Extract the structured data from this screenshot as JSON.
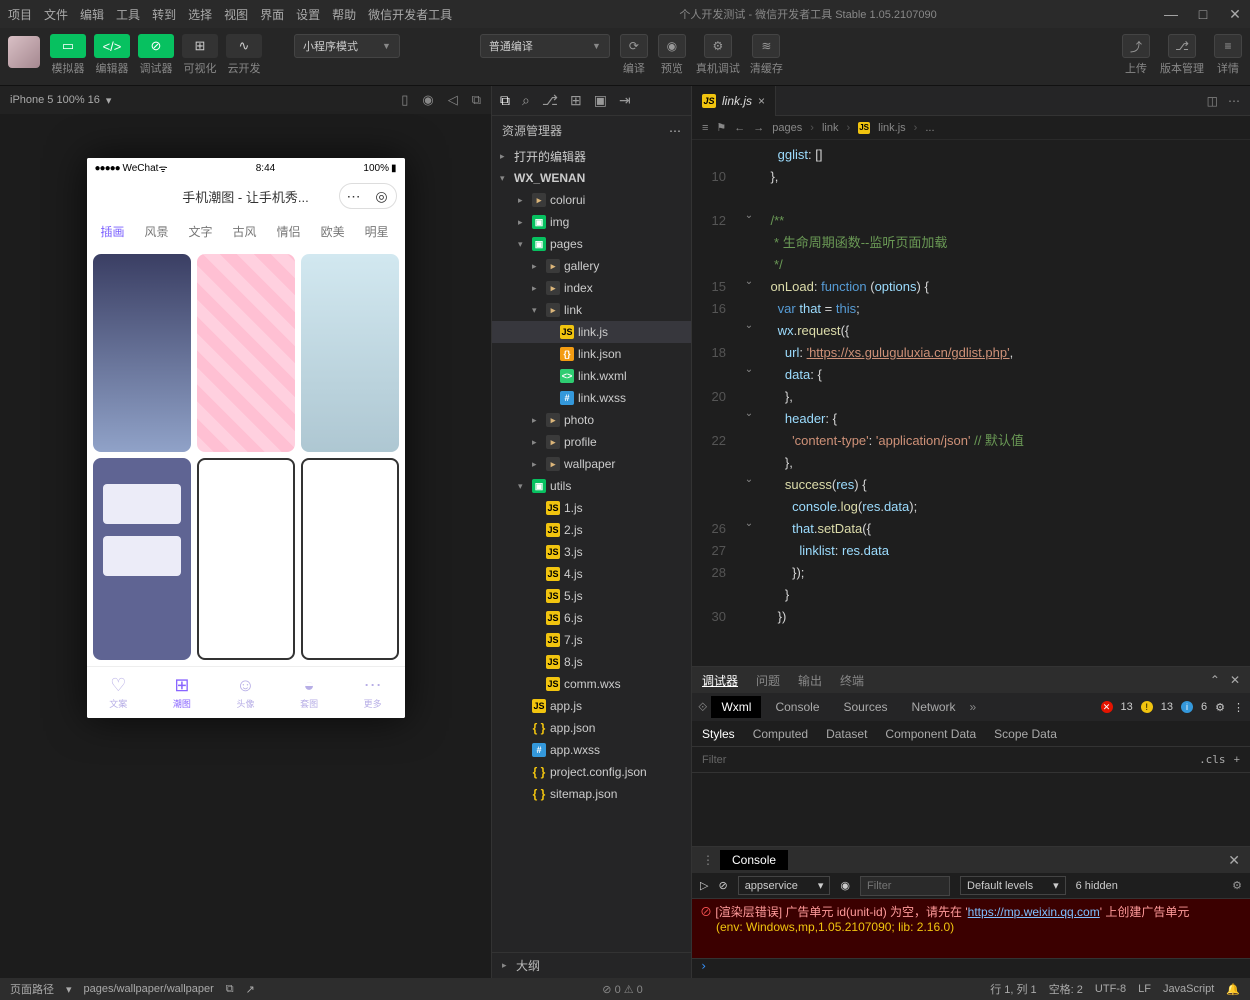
{
  "menu": [
    "项目",
    "文件",
    "编辑",
    "工具",
    "转到",
    "选择",
    "视图",
    "界面",
    "设置",
    "帮助",
    "微信开发者工具"
  ],
  "window_title": "个人开发测试 - 微信开发者工具 Stable 1.05.2107090",
  "toolbar": {
    "sim": "模拟器",
    "editor": "编辑器",
    "debugger": "调试器",
    "visual": "可视化",
    "cloud": "云开发",
    "mode": "小程序模式",
    "compile_mode": "普通编译",
    "compile": "编译",
    "preview": "预览",
    "truedbg": "真机调试",
    "clear_cache": "清缓存",
    "upload": "上传",
    "version": "版本管理",
    "details": "详情"
  },
  "sim": {
    "device": "iPhone 5 100% 16",
    "arrow": "▾"
  },
  "phone": {
    "carrier": "WeChat",
    "time": "8:44",
    "battery": "100%",
    "title": "手机潮图 - 让手机秀...",
    "tabs": [
      "插画",
      "风景",
      "文字",
      "古风",
      "情侣",
      "欧美",
      "明星"
    ],
    "tabbar": [
      {
        "icon": "♡",
        "label": "文案"
      },
      {
        "icon": "⊞",
        "label": "潮图"
      },
      {
        "icon": "☺",
        "label": "头像"
      },
      {
        "icon": "◒",
        "label": "套图"
      },
      {
        "icon": "⋯",
        "label": "更多"
      }
    ]
  },
  "explorer": {
    "title": "资源管理器",
    "sections": {
      "open_editors": "打开的编辑器",
      "project": "WX_WENAN",
      "outline": "大纲"
    },
    "tree": [
      {
        "d": 1,
        "tw": "▸",
        "ico": "folder",
        "name": "colorui"
      },
      {
        "d": 1,
        "tw": "▸",
        "ico": "pages",
        "name": "img"
      },
      {
        "d": 1,
        "tw": "▾",
        "ico": "pages",
        "name": "pages"
      },
      {
        "d": 2,
        "tw": "▸",
        "ico": "folder",
        "name": "gallery"
      },
      {
        "d": 2,
        "tw": "▸",
        "ico": "folder",
        "name": "index"
      },
      {
        "d": 2,
        "tw": "▾",
        "ico": "folder",
        "name": "link"
      },
      {
        "d": 3,
        "tw": "",
        "ico": "js",
        "name": "link.js",
        "sel": true
      },
      {
        "d": 3,
        "tw": "",
        "ico": "json",
        "name": "link.json"
      },
      {
        "d": 3,
        "tw": "",
        "ico": "wxml",
        "name": "link.wxml"
      },
      {
        "d": 3,
        "tw": "",
        "ico": "wxss",
        "name": "link.wxss"
      },
      {
        "d": 2,
        "tw": "▸",
        "ico": "folder",
        "name": "photo"
      },
      {
        "d": 2,
        "tw": "▸",
        "ico": "folder",
        "name": "profile"
      },
      {
        "d": 2,
        "tw": "▸",
        "ico": "folder",
        "name": "wallpaper"
      },
      {
        "d": 1,
        "tw": "▾",
        "ico": "utils",
        "name": "utils"
      },
      {
        "d": 2,
        "tw": "",
        "ico": "js",
        "name": "1.js"
      },
      {
        "d": 2,
        "tw": "",
        "ico": "js",
        "name": "2.js"
      },
      {
        "d": 2,
        "tw": "",
        "ico": "js",
        "name": "3.js"
      },
      {
        "d": 2,
        "tw": "",
        "ico": "js",
        "name": "4.js"
      },
      {
        "d": 2,
        "tw": "",
        "ico": "js",
        "name": "5.js"
      },
      {
        "d": 2,
        "tw": "",
        "ico": "js",
        "name": "6.js"
      },
      {
        "d": 2,
        "tw": "",
        "ico": "js",
        "name": "7.js"
      },
      {
        "d": 2,
        "tw": "",
        "ico": "js",
        "name": "8.js"
      },
      {
        "d": 2,
        "tw": "",
        "ico": "js",
        "name": "comm.wxs"
      },
      {
        "d": 1,
        "tw": "",
        "ico": "js",
        "name": "app.js"
      },
      {
        "d": 1,
        "tw": "",
        "ico": "json2",
        "name": "app.json"
      },
      {
        "d": 1,
        "tw": "",
        "ico": "wxss",
        "name": "app.wxss"
      },
      {
        "d": 1,
        "tw": "",
        "ico": "json2",
        "name": "project.config.json"
      },
      {
        "d": 1,
        "tw": "",
        "ico": "json2",
        "name": "sitemap.json"
      }
    ]
  },
  "editor": {
    "tab": "link.js",
    "breadcrumb": [
      "pages",
      "link",
      "link.js",
      "..."
    ],
    "lines": [
      {
        "n": "",
        "fold": "",
        "html": "      <span class='c-prop'>gglist</span>: []"
      },
      {
        "n": "10",
        "fold": "",
        "html": "    },"
      },
      {
        "n": "",
        "fold": "",
        "html": ""
      },
      {
        "n": "12",
        "fold": "⌄",
        "html": "    <span class='c-comment'>/**</span>"
      },
      {
        "n": "",
        "fold": "",
        "html": "<span class='c-comment'>     * 生命周期函数--监听页面加载</span>"
      },
      {
        "n": "",
        "fold": "",
        "html": "<span class='c-comment'>     */</span>"
      },
      {
        "n": "15",
        "fold": "⌄",
        "html": "    <span class='c-method'>onLoad</span>: <span class='c-func'>function</span> (<span class='c-var'>options</span>) {"
      },
      {
        "n": "16",
        "fold": "",
        "html": "      <span class='c-func'>var</span> <span class='c-var'>that</span> = <span class='c-func'>this</span>;"
      },
      {
        "n": "",
        "fold": "⌄",
        "html": "      <span class='c-var'>wx</span>.<span class='c-method'>request</span>({"
      },
      {
        "n": "18",
        "fold": "",
        "html": "        <span class='c-prop'>url</span>: <span class='c-url'>'https://xs.guluguluxia.cn/gdlist.php'</span>,"
      },
      {
        "n": "",
        "fold": "⌄",
        "html": "        <span class='c-prop'>data</span>: {"
      },
      {
        "n": "20",
        "fold": "",
        "html": "        },"
      },
      {
        "n": "",
        "fold": "⌄",
        "html": "        <span class='c-prop'>header</span>: {"
      },
      {
        "n": "22",
        "fold": "",
        "html": "          <span class='c-str'>'content-type'</span>: <span class='c-str'>'application/json'</span> <span class='c-comment'>// 默认值</span>"
      },
      {
        "n": "",
        "fold": "",
        "html": "        },"
      },
      {
        "n": "",
        "fold": "⌄",
        "html": "        <span class='c-method'>success</span>(<span class='c-var'>res</span>) {"
      },
      {
        "n": "",
        "fold": "",
        "html": "          <span class='c-var'>console</span>.<span class='c-method'>log</span>(<span class='c-var'>res</span>.<span class='c-var'>data</span>);"
      },
      {
        "n": "26",
        "fold": "⌄",
        "html": "          <span class='c-var'>that</span>.<span class='c-method'>setData</span>({"
      },
      {
        "n": "27",
        "fold": "",
        "html": "            <span class='c-prop'>linklist</span>: <span class='c-var'>res</span>.<span class='c-var'>data</span>"
      },
      {
        "n": "28",
        "fold": "",
        "html": "          });"
      },
      {
        "n": "",
        "fold": "",
        "html": "        }"
      },
      {
        "n": "30",
        "fold": "",
        "html": "      })"
      }
    ]
  },
  "dbg": {
    "top_tabs": [
      "调试器",
      "问题",
      "输出",
      "终端"
    ],
    "tool_tabs": [
      "Wxml",
      "Console",
      "Sources",
      "Network"
    ],
    "errors": "13",
    "warnings": "13",
    "info": "6",
    "style_tabs": [
      "Styles",
      "Computed",
      "Dataset",
      "Component Data",
      "Scope Data"
    ],
    "filter_placeholder": "Filter",
    "cls": ".cls"
  },
  "console": {
    "tab": "Console",
    "context": "appservice",
    "filter_placeholder": "Filter",
    "levels": "Default levels",
    "hidden": "6 hidden",
    "err_line1_a": "[渲染层错误] 广告单元 id(unit-id) 为空，请先在 '",
    "err_url": "https://mp.weixin.qq.com",
    "err_line1_b": "' 上创建广告单元",
    "err_line2": "(env: Windows,mp,1.05.2107090; lib: 2.16.0)"
  },
  "status": {
    "path_label": "页面路径",
    "path": "pages/wallpaper/wallpaper",
    "errs": "0",
    "warns": "0",
    "pos": "行 1, 列 1",
    "spaces": "空格: 2",
    "enc": "UTF-8",
    "eol": "LF",
    "lang": "JavaScript"
  }
}
